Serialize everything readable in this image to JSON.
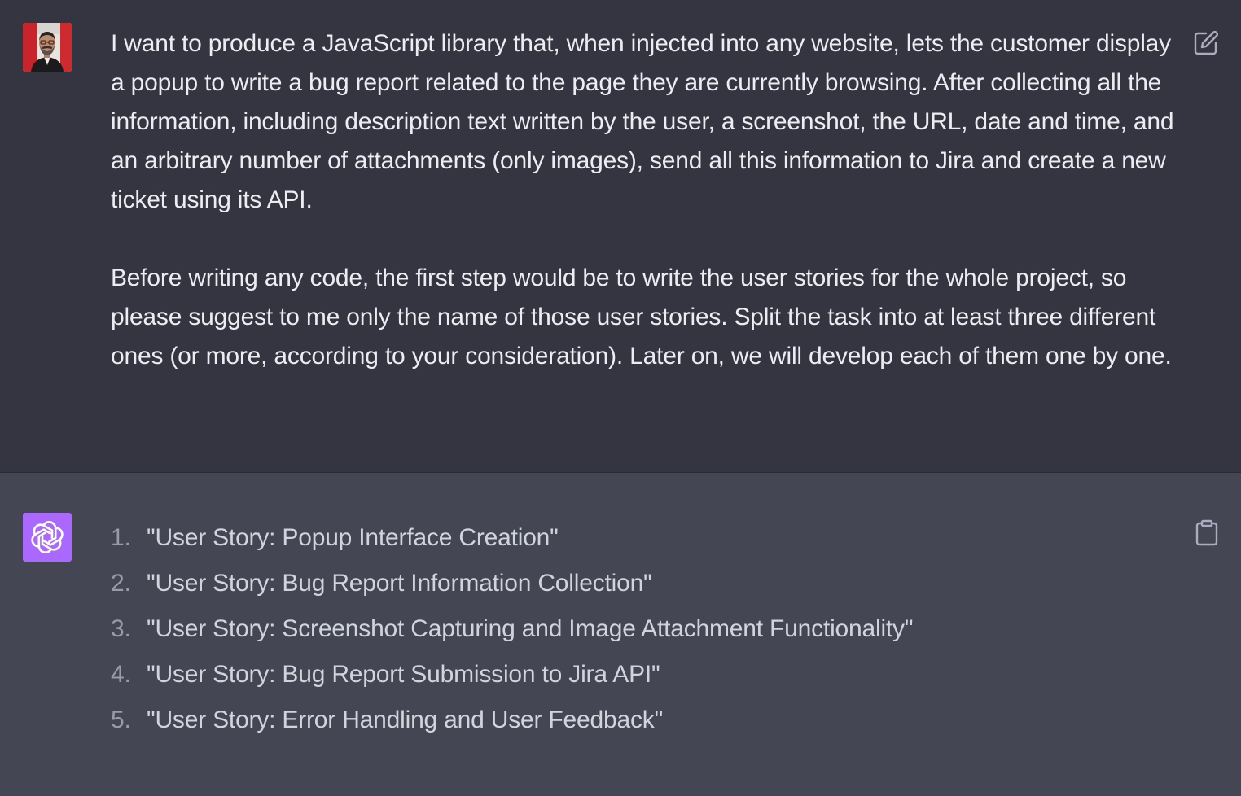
{
  "user_message": {
    "paragraphs": [
      "I want to produce a JavaScript library that, when injected into any website, lets the customer display a popup to write a bug report related to the page they are currently browsing. After collecting all the information, including description text written by the user, a screenshot, the URL, date and time, and an arbitrary number of attachments (only images), send all this information to Jira and create a new ticket using its API.",
      "Before writing any code, the first step would be to write the user stories for the whole project, so please suggest to me only the name of those user stories. Split the task into at least three different ones (or more, according to your consideration). Later on, we will develop each of them one by one."
    ],
    "avatar_icon": "user-photo",
    "action_icon": "edit-icon"
  },
  "assistant_message": {
    "avatar_icon": "openai-logo-icon",
    "avatar_color": "#ab68ff",
    "action_icon": "clipboard-icon",
    "items": [
      {
        "num": "1.",
        "text": "\"User Story: Popup Interface Creation\""
      },
      {
        "num": "2.",
        "text": "\"User Story: Bug Report Information Collection\""
      },
      {
        "num": "3.",
        "text": "\"User Story: Screenshot Capturing and Image Attachment Functionality\""
      },
      {
        "num": "4.",
        "text": "\"User Story: Bug Report Submission to Jira API\""
      },
      {
        "num": "5.",
        "text": "\"User Story: Error Handling and User Feedback\""
      }
    ]
  },
  "colors": {
    "user_bg": "#343541",
    "assistant_bg": "#444654",
    "text": "#ececf1"
  }
}
